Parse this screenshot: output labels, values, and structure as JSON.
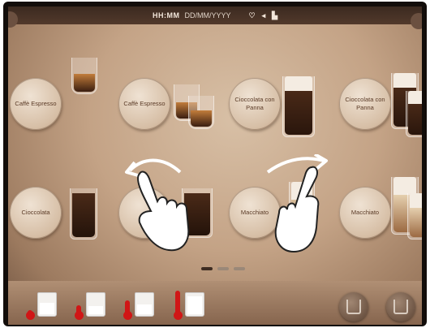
{
  "status_bar": {
    "time": "HH:MM",
    "date": "DD/MM/YYYY",
    "icons": [
      "wifi-icon",
      "volume-icon",
      "user-icon"
    ]
  },
  "drinks": [
    {
      "label": "Caffè Espresso",
      "cup": "espresso"
    },
    {
      "label": "Caffè Espresso",
      "cup": "double-espresso"
    },
    {
      "label": "Cioccolata con Panna",
      "cup": "tall-cream"
    },
    {
      "label": "Cioccolata con Panna",
      "cup": "double-tall-cream"
    },
    {
      "label": "Cioccolata",
      "cup": "chocolate"
    },
    {
      "label": "",
      "cup": "chocolate"
    },
    {
      "label": "Macchiato",
      "cup": "macchiato"
    },
    {
      "label": "Macchiato",
      "cup": "double-macchiato"
    }
  ],
  "pager": {
    "pages": 3,
    "current": 1
  },
  "milk_temperatures": [
    0.2,
    0.4,
    0.6,
    0.85
  ],
  "gestures": [
    "swipe-left-hand-icon",
    "swipe-right-hand-icon"
  ],
  "bottom_buttons": [
    "cup-size-button",
    "double-cup-button"
  ]
}
